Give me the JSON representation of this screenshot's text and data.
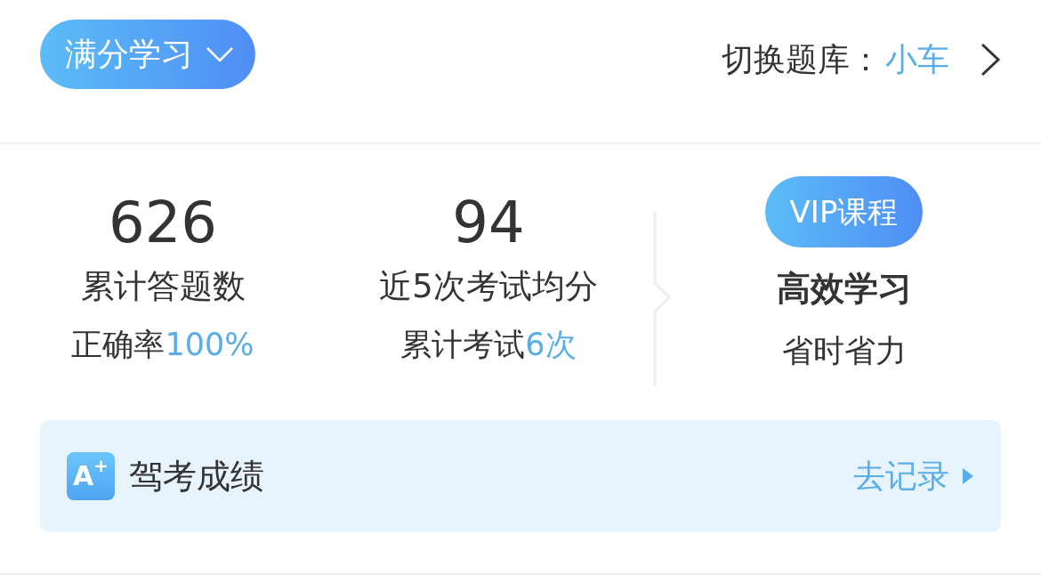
{
  "header": {
    "mode_button": "满分学习",
    "switch_label": "切换题库：",
    "switch_value": "小车"
  },
  "stats": [
    {
      "value": "626",
      "label": "累计答题数",
      "sub": "正确率",
      "sub_highlight": "100%"
    },
    {
      "value": "94",
      "label": "近5次考试均分",
      "sub": "累计考试",
      "sub_highlight": "6次"
    }
  ],
  "promo": {
    "badge": "VIP课程",
    "title": "高效学习",
    "subtitle": "省时省力"
  },
  "record": {
    "icon_text": "A$^{+}$",
    "title": "驾考成绩",
    "link": "去记录"
  }
}
